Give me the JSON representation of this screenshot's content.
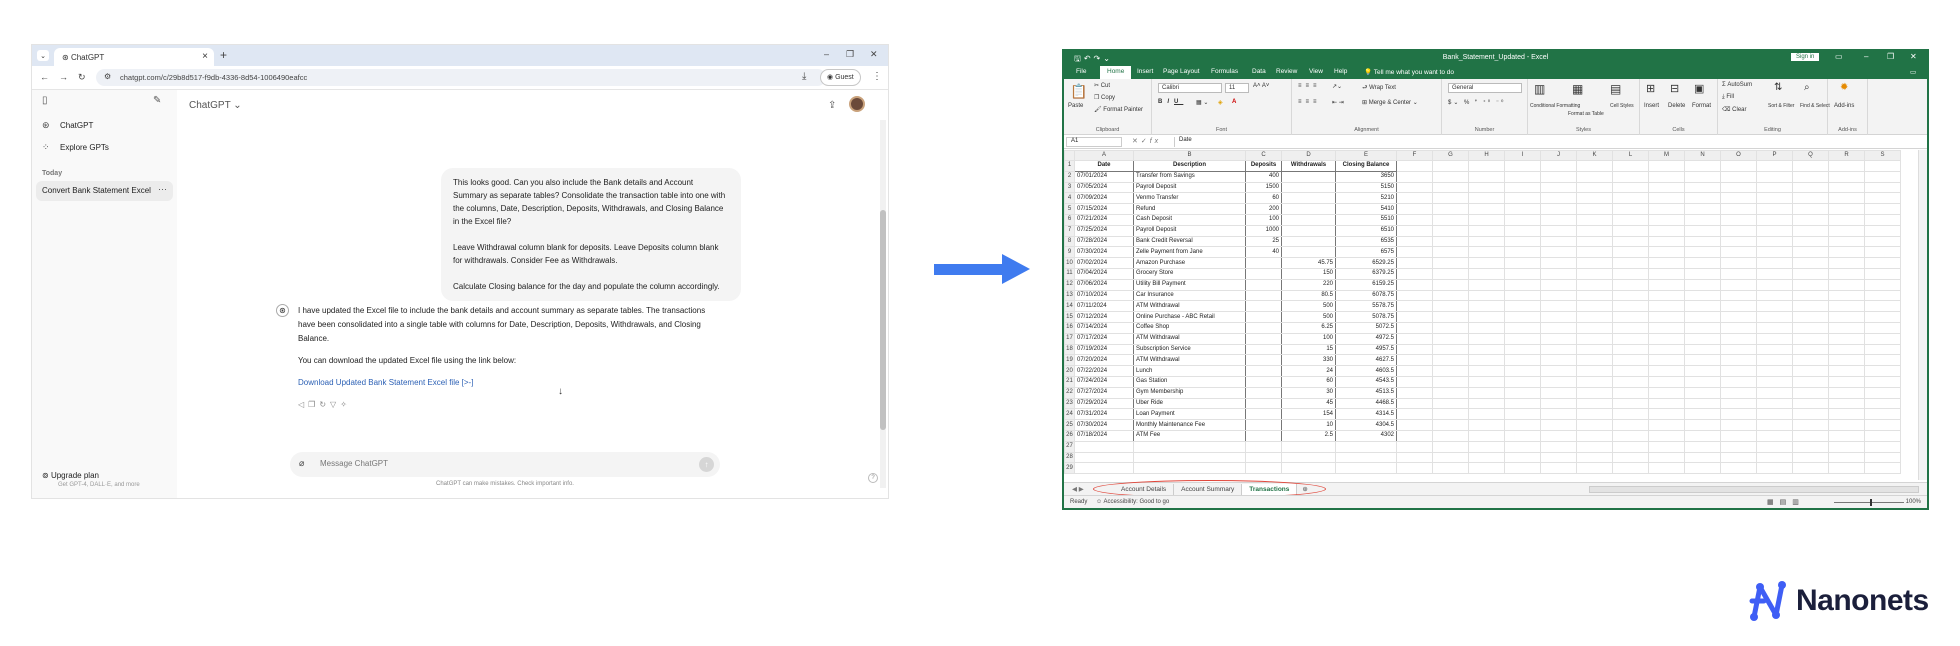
{
  "browser": {
    "tab_title": "ChatGPT",
    "url": "chatgpt.com/c/29b8d517-f9db-4336-8d54-1006490eafcc",
    "guest_label": "Guest"
  },
  "sidebar": {
    "items": [
      {
        "label": "ChatGPT"
      },
      {
        "label": "Explore GPTs"
      }
    ],
    "section_today": "Today",
    "conversation": "Convert Bank Statement Excel",
    "upgrade_title": "Upgrade plan",
    "upgrade_sub": "Get GPT-4, DALL·E, and more"
  },
  "chat": {
    "model": "ChatGPT",
    "user_message": [
      "This looks good. Can you also include the Bank details and Account Summary as separate tables? Consolidate the transaction table into one with the columns, Date, Description, Deposits, Withdrawals, and Closing Balance in the Excel file?",
      "Leave Withdrawal column blank for deposits. Leave Deposits column blank for withdrawals. Consider Fee as Withdrawals.",
      "Calculate Closing balance for the day and populate the column accordingly."
    ],
    "assistant_message": [
      "I have updated the Excel file to include the bank details and account summary as separate tables. The transactions have been consolidated into a single table with columns for Date, Description, Deposits, Withdrawals, and Closing Balance.",
      "You can download the updated Excel file using the link below:"
    ],
    "download_link": "Download Updated Bank Statement Excel file [>-]",
    "input_placeholder": "Message ChatGPT",
    "disclaimer": "ChatGPT can make mistakes. Check important info."
  },
  "excel": {
    "title": "Bank_Statement_Updated - Excel",
    "sign_in": "Sign in",
    "menu": [
      "File",
      "Home",
      "Insert",
      "Page Layout",
      "Formulas",
      "Data",
      "Review",
      "View",
      "Help",
      "Tell me what you want to do"
    ],
    "ribbon": {
      "clipboard": {
        "label": "Clipboard",
        "paste": "Paste",
        "cut": "Cut",
        "copy": "Copy",
        "format_painter": "Format Painter"
      },
      "font": {
        "label": "Font",
        "name": "Calibri",
        "size": "11"
      },
      "alignment": {
        "label": "Alignment",
        "wrap": "Wrap Text",
        "merge": "Merge & Center"
      },
      "number": {
        "label": "Number",
        "format": "General"
      },
      "styles": {
        "label": "Styles",
        "cond": "Conditional Formatting",
        "table": "Format as Table",
        "cell": "Cell Styles"
      },
      "cells": {
        "label": "Cells",
        "insert": "Insert",
        "delete": "Delete",
        "format": "Format"
      },
      "editing": {
        "label": "Editing",
        "autosum": "AutoSum",
        "fill": "Fill",
        "clear": "Clear",
        "sort": "Sort & Filter",
        "find": "Find & Select"
      },
      "addins": {
        "label": "Add-ins",
        "btn": "Add-ins"
      }
    },
    "name_box": "A1",
    "formula_value": "Date",
    "columns": [
      "A",
      "B",
      "C",
      "D",
      "E",
      "F",
      "G",
      "H",
      "I",
      "J",
      "K",
      "L",
      "M",
      "N",
      "O",
      "P",
      "Q",
      "R",
      "S"
    ],
    "headers": [
      "Date",
      "Description",
      "Deposits",
      "Withdrawals",
      "Closing Balance"
    ],
    "rows": [
      [
        "07/01/2024",
        "Transfer from Savings",
        "400",
        "",
        "3650"
      ],
      [
        "07/05/2024",
        "Payroll Deposit",
        "1500",
        "",
        "5150"
      ],
      [
        "07/09/2024",
        "Venmo Transfer",
        "60",
        "",
        "5210"
      ],
      [
        "07/15/2024",
        "Refund",
        "200",
        "",
        "5410"
      ],
      [
        "07/21/2024",
        "Cash Deposit",
        "100",
        "",
        "5510"
      ],
      [
        "07/25/2024",
        "Payroll Deposit",
        "1000",
        "",
        "6510"
      ],
      [
        "07/28/2024",
        "Bank Credit Reversal",
        "25",
        "",
        "6535"
      ],
      [
        "07/30/2024",
        "Zelle Payment from Jane",
        "40",
        "",
        "6575"
      ],
      [
        "07/02/2024",
        "Amazon Purchase",
        "",
        "45.75",
        "6529.25"
      ],
      [
        "07/04/2024",
        "Grocery Store",
        "",
        "150",
        "6379.25"
      ],
      [
        "07/06/2024",
        "Utility Bill Payment",
        "",
        "220",
        "6159.25"
      ],
      [
        "07/10/2024",
        "Car Insurance",
        "",
        "80.5",
        "6078.75"
      ],
      [
        "07/11/2024",
        "ATM Withdrawal",
        "",
        "500",
        "5578.75"
      ],
      [
        "07/12/2024",
        "Online Purchase - ABC Retail",
        "",
        "500",
        "5078.75"
      ],
      [
        "07/14/2024",
        "Coffee Shop",
        "",
        "6.25",
        "5072.5"
      ],
      [
        "07/17/2024",
        "ATM Withdrawal",
        "",
        "100",
        "4972.5"
      ],
      [
        "07/19/2024",
        "Subscription Service",
        "",
        "15",
        "4957.5"
      ],
      [
        "07/20/2024",
        "ATM Withdrawal",
        "",
        "330",
        "4627.5"
      ],
      [
        "07/22/2024",
        "Lunch",
        "",
        "24",
        "4603.5"
      ],
      [
        "07/24/2024",
        "Gas Station",
        "",
        "60",
        "4543.5"
      ],
      [
        "07/27/2024",
        "Gym Membership",
        "",
        "30",
        "4513.5"
      ],
      [
        "07/29/2024",
        "Uber Ride",
        "",
        "45",
        "4468.5"
      ],
      [
        "07/31/2024",
        "Loan Payment",
        "",
        "154",
        "4314.5"
      ],
      [
        "07/30/2024",
        "Monthly Maintenance Fee",
        "",
        "10",
        "4304.5"
      ],
      [
        "07/18/2024",
        "ATM Fee",
        "",
        "2.5",
        "4302"
      ]
    ],
    "sheets": [
      "Account Details",
      "Account Summary",
      "Transactions"
    ],
    "active_sheet": "Transactions",
    "status_ready": "Ready",
    "status_accessibility": "Accessibility: Good to go",
    "zoom": "100%"
  },
  "brand": {
    "name": "Nanonets"
  },
  "colors": {
    "excel_green": "#217346",
    "arrow_blue": "#3f7bef",
    "highlight_red": "#e0463a",
    "link_blue": "#2d61b5"
  }
}
